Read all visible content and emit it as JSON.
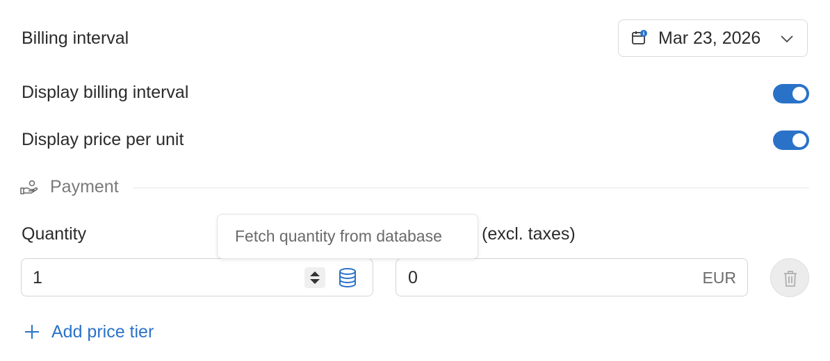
{
  "rows": {
    "billing_interval": "Billing interval",
    "display_billing_interval": "Display billing interval",
    "display_price_per_unit": "Display price per unit"
  },
  "date_picker": {
    "value": "Mar 23, 2026"
  },
  "toggles": {
    "display_billing_interval": {
      "on": true
    },
    "display_price_per_unit": {
      "on": true
    }
  },
  "section": {
    "label": "Payment"
  },
  "quantity": {
    "label": "Quantity",
    "value": "1"
  },
  "price": {
    "label_visible": "(excl. taxes)",
    "value": "0",
    "currency": "EUR"
  },
  "tooltip": {
    "text": "Fetch quantity from database"
  },
  "add_tier": {
    "label": "Add price tier"
  },
  "colors": {
    "accent": "#2a72c8",
    "border": "#d3d3d3",
    "muted": "#7a7a7a"
  }
}
